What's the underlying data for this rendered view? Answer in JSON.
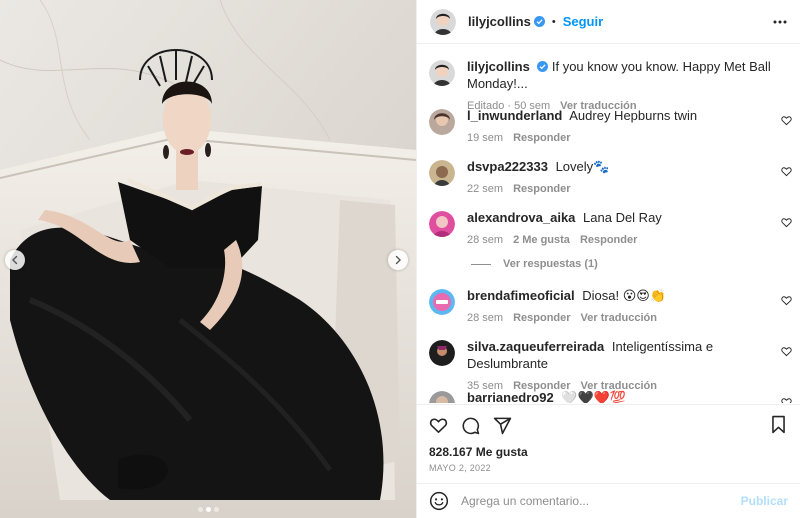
{
  "post": {
    "author": "lilyjcollins",
    "follow_label": "Seguir",
    "separator": "•",
    "caption_text": "If you know you know. Happy Met Ball Monday!...",
    "caption_edited": "Editado · 50 sem",
    "caption_translate": "Ver traducción"
  },
  "comments": [
    {
      "user": "l_inwunderland",
      "text": "Audrey Hepburns twin",
      "time": "19 sem",
      "likes": "",
      "reply": "Responder",
      "translate": ""
    },
    {
      "user": "dsvpa222333",
      "text": "Lovely🐾",
      "time": "22 sem",
      "likes": "",
      "reply": "Responder",
      "translate": ""
    },
    {
      "user": "alexandrova_aika",
      "text": "Lana Del Ray",
      "time": "28 sem",
      "likes": "2 Me gusta",
      "reply": "Responder",
      "translate": ""
    },
    {
      "user": "brendafimeoficial",
      "text": "Diosa! 😮😍👏",
      "time": "28 sem",
      "likes": "",
      "reply": "Responder",
      "translate": "Ver traducción"
    },
    {
      "user": "silva.zaqueuferreirada",
      "text": "Inteligentíssima e Deslumbrante",
      "time": "35 sem",
      "likes": "",
      "reply": "Responder",
      "translate": "Ver traducción"
    },
    {
      "user": "barrianedro92",
      "text": "🤍🖤❤️💯",
      "time": "",
      "likes": "",
      "reply": "",
      "translate": ""
    }
  ],
  "replies_label": "Ver respuestas (1)",
  "likes_count": "828.167 Me gusta",
  "post_date": "Mayo 2, 2022",
  "add_comment": {
    "placeholder": "Agrega un comentario...",
    "publish_label": "Publicar"
  },
  "carousel": {
    "total_slides": 3,
    "active_index": 1
  },
  "colors": {
    "link_blue": "#0095f6",
    "verified_blue": "#3897f0",
    "publish_disabled": "#b2dffc",
    "muted_text": "#8e8e8e"
  },
  "icons": [
    "verified-icon",
    "more-icon",
    "heart-icon",
    "comment-icon",
    "share-icon",
    "bookmark-icon",
    "emoji-icon",
    "chevron-left-icon",
    "chevron-right-icon"
  ]
}
